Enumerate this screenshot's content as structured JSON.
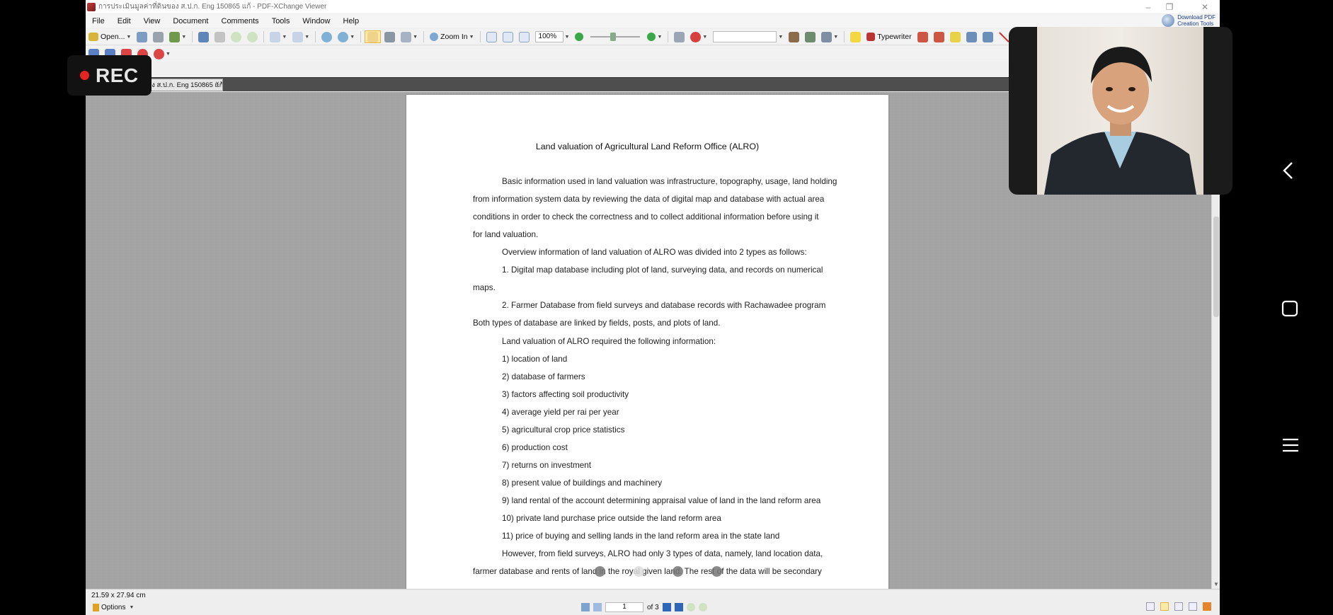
{
  "window": {
    "title": "การประเมินมูลค่าที่ดินของ ส.ป.ก. Eng 150865 แก้ - PDF-XChange Viewer",
    "controls": [
      "–",
      "❐",
      "✕"
    ]
  },
  "menubar": {
    "items": [
      "File",
      "Edit",
      "View",
      "Document",
      "Comments",
      "Tools",
      "Window",
      "Help"
    ],
    "download_tools": [
      "Download PDF",
      "Creation Tools"
    ]
  },
  "toolbar": {
    "open_label": "Open...",
    "zoom_in_label": "Zoom In",
    "zoom_value": "100%",
    "typewriter_label": "Typewriter"
  },
  "tab": {
    "label": "ของ ส.ป.ก. Eng 150865 แก้",
    "close": "×"
  },
  "document": {
    "title": "Land valuation of Agricultural Land Reform Office (ALRO)",
    "lines": [
      "Basic information used in land valuation was infrastructure, topography, usage, land holding",
      "from information system data by reviewing the data of digital map and database with actual area",
      "conditions in order to check the correctness and to collect additional information before using it",
      "for land valuation.",
      "Overview information of land valuation of ALRO was divided into 2 types as follows:",
      "1. Digital map database including plot of land, surveying data, and records on numerical",
      "maps.",
      "2. Farmer Database from field surveys and database records with Rachawadee program",
      "Both types of database are linked by fields, posts, and plots of land.",
      "Land valuation of ALRO required the following information:",
      "1) location of land",
      "2) database of farmers",
      "3) factors affecting soil productivity",
      "4) average yield per rai per year",
      "5) agricultural crop price statistics",
      "6) production cost",
      "7) returns on investment",
      "8) present value of buildings and machinery",
      "9) land rental of the account determining appraisal value of land in the land reform area",
      "10) private land purchase price outside the land reform area",
      "11) price of buying and selling lands in the land reform area in the state land",
      "However, from field surveys, ALRO had only 3 types of data, namely, land location data,",
      "farmer database and rents of land in the royal given land. The rest of the data will be secondary"
    ]
  },
  "statusbar": {
    "dimensions": "21.59 x 27.94 cm",
    "options_label": "Options",
    "page_current": "1",
    "page_total": "of 3"
  },
  "overlay": {
    "rec_label": "REC"
  },
  "colors": {
    "rec_dot": "#e52421",
    "doc_background": "#a3a3a3",
    "tab_strip": "#4e4e4e"
  }
}
